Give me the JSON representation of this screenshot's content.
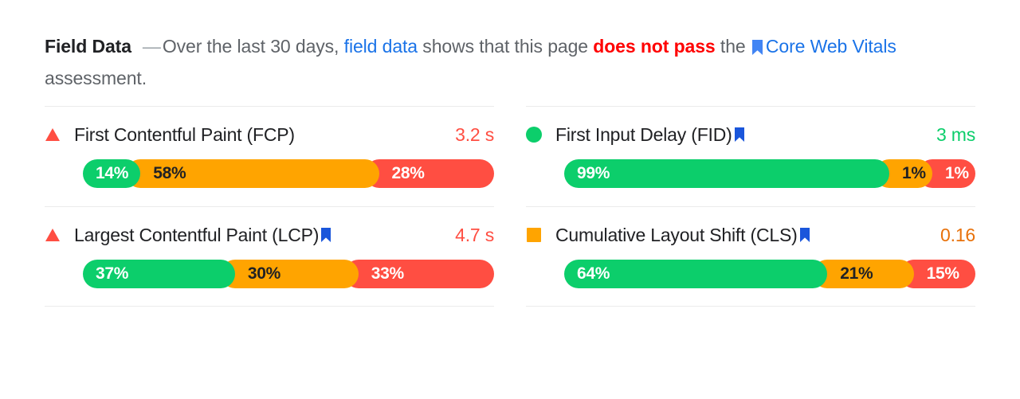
{
  "header": {
    "title": "Field Data",
    "dash": "—",
    "text_1": "Over the last 30 days, ",
    "link_field_data": "field data",
    "text_2": " shows that this page ",
    "fail_text": "does not pass",
    "text_3": " the ",
    "link_cwv": "Core Web Vitals",
    "text_4": " assessment.",
    "flag_icon": "bookmark-icon"
  },
  "colors": {
    "good": "#0CCE6B",
    "average": "#FFA400",
    "poor": "#FF4E42",
    "link": "#1A73E8",
    "flag": "#4285F4",
    "fail": "#FF0000",
    "divider": "#EBEBEB"
  },
  "metrics": [
    {
      "id": "fcp",
      "name": "First Contentful Paint (FCP)",
      "value": "3.2 s",
      "value_color": "#FF4E42",
      "status": "poor",
      "status_icon": "triangle-icon",
      "is_core_web_vital": false,
      "distribution": [
        {
          "label": "14%",
          "percent": 14,
          "bucket": "good"
        },
        {
          "label": "58%",
          "percent": 58,
          "bucket": "average"
        },
        {
          "label": "28%",
          "percent": 28,
          "bucket": "poor"
        }
      ]
    },
    {
      "id": "fid",
      "name": "First Input Delay (FID)",
      "value": "3 ms",
      "value_color": "#0CCE6B",
      "status": "good",
      "status_icon": "circle-icon",
      "is_core_web_vital": true,
      "distribution": [
        {
          "label": "99%",
          "percent": 99,
          "bucket": "good"
        },
        {
          "label": "1%",
          "percent": 1,
          "bucket": "average"
        },
        {
          "label": "1%",
          "percent": 1,
          "bucket": "poor"
        }
      ]
    },
    {
      "id": "lcp",
      "name": "Largest Contentful Paint (LCP)",
      "value": "4.7 s",
      "value_color": "#FF4E42",
      "status": "poor",
      "status_icon": "triangle-icon",
      "is_core_web_vital": true,
      "distribution": [
        {
          "label": "37%",
          "percent": 37,
          "bucket": "good"
        },
        {
          "label": "30%",
          "percent": 30,
          "bucket": "average"
        },
        {
          "label": "33%",
          "percent": 33,
          "bucket": "poor"
        }
      ]
    },
    {
      "id": "cls",
      "name": "Cumulative Layout Shift (CLS)",
      "value": "0.16",
      "value_color": "#E8710A",
      "status": "average",
      "status_icon": "square-icon",
      "is_core_web_vital": true,
      "distribution": [
        {
          "label": "64%",
          "percent": 64,
          "bucket": "good"
        },
        {
          "label": "21%",
          "percent": 21,
          "bucket": "average"
        },
        {
          "label": "15%",
          "percent": 15,
          "bucket": "poor"
        }
      ]
    }
  ]
}
